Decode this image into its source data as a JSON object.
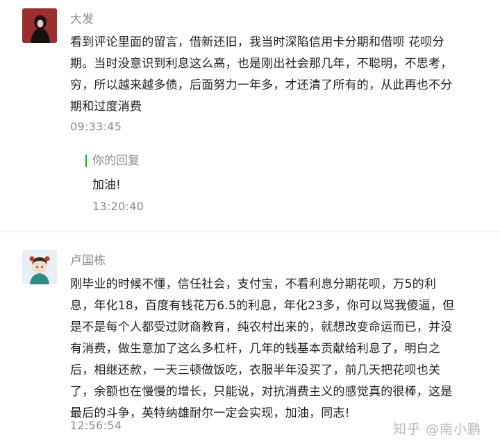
{
  "comments": [
    {
      "author": "大发",
      "text_lines": [
        "看到评论里面的留言，借新还旧，我当时深陷信用卡分期和借呗 花呗分",
        "期。当时没意识到利息这么高，也是刚出社会那几年，不聪明，不思考，",
        "穷，所以越来越多债，后面努力一年多，才还清了所有的，从此再也不分",
        "期和过度消费"
      ],
      "time": "09:33:45",
      "reply": {
        "label": "你的回复",
        "text": "加油!",
        "time": "13:20:40"
      }
    },
    {
      "author": "卢国栋",
      "text_lines": [
        "刚毕业的时候不懂，信任社会，支付宝，不看利息分期花呗，万5的利",
        "息，年化18，百度有钱花万6.5的利息，年化23多，你可以骂我傻逼，但",
        "是不是每个人都受过财商教育，纯农村出来的，就想改变命运而已，并没",
        "有消费，做生意加了这么多杠杆，几年的钱基本贡献给利息了，明白之",
        "后，相继还款，一天三顿做饭吃，衣服半年没买了，前几天把花呗也关",
        "了，余额也在慢慢的增长，只能说，对抗消费主义的感觉真的很棒，这是",
        "最后的斗争，英特纳雄耐尔一定会实现，加油，同志!"
      ],
      "time": "12:56:54"
    }
  ],
  "watermark": "知乎 @南小鹏",
  "colors": {
    "reply_bar": "#1aad19",
    "meta_text": "#8a8a8a"
  }
}
